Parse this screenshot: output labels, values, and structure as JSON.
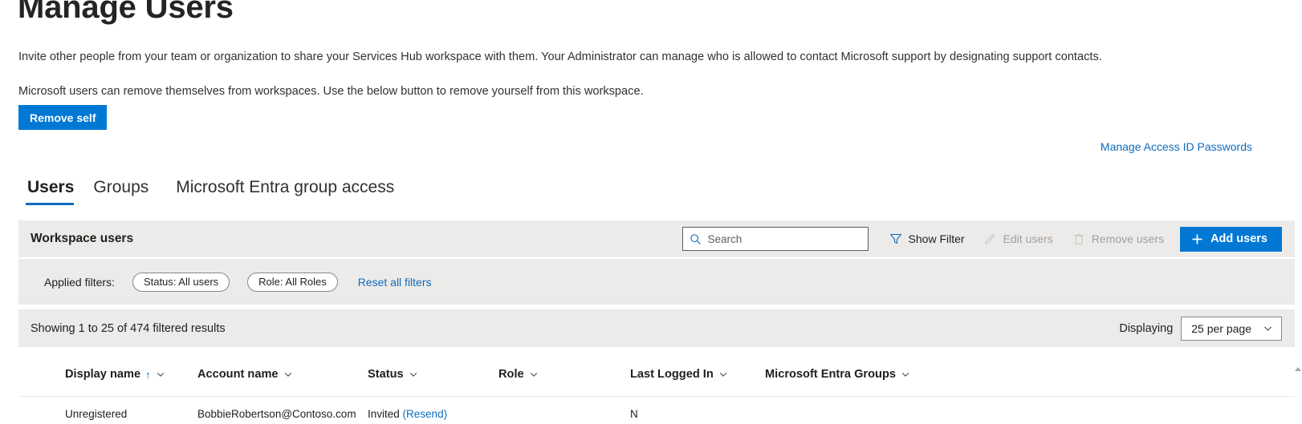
{
  "header": {
    "title": "Manage Users",
    "intro_paragraph_1": "Invite other people from your team or organization to share your Services Hub workspace with them. Your Administrator can manage who is allowed to contact Microsoft support by designating support contacts.",
    "intro_paragraph_2": "Microsoft users can remove themselves from workspaces. Use the below button to remove yourself from this workspace.",
    "remove_self_label": "Remove self",
    "manage_access_link": "Manage Access ID Passwords"
  },
  "tabs": [
    {
      "label": "Users",
      "active": true
    },
    {
      "label": "Groups",
      "active": false
    },
    {
      "label": "Microsoft Entra group access",
      "active": false
    }
  ],
  "toolbar": {
    "panel_title": "Workspace users",
    "search_placeholder": "Search",
    "search_value": "",
    "show_filter_label": "Show Filter",
    "edit_users_label": "Edit users",
    "remove_users_label": "Remove users",
    "add_users_label": "Add users"
  },
  "filters": {
    "applied_label": "Applied filters:",
    "chips": [
      {
        "label": "Status: All users"
      },
      {
        "label": "Role: All Roles"
      }
    ],
    "reset_label": "Reset all filters"
  },
  "paging": {
    "showing_text": "Showing 1 to 25 of 474 filtered results",
    "displaying_label": "Displaying",
    "per_page_value": "25 per page"
  },
  "table": {
    "columns": [
      {
        "label": "Display name",
        "sorted": "asc"
      },
      {
        "label": "Account name",
        "sorted": ""
      },
      {
        "label": "Status",
        "sorted": ""
      },
      {
        "label": "Role",
        "sorted": ""
      },
      {
        "label": "Last Logged In",
        "sorted": ""
      },
      {
        "label": "Microsoft Entra Groups",
        "sorted": ""
      }
    ],
    "rows": [
      {
        "display_name": "Unregistered",
        "account_name": "BobbieRobertson@Contoso.com",
        "status": "Invited",
        "status_action": "(Resend)",
        "role": "",
        "last_logged_in": "N",
        "entra_groups": ""
      }
    ]
  },
  "colors": {
    "accent_blue": "#0078d4",
    "link_blue": "#0f6cbd",
    "band_gray": "#edebe9",
    "disabled_gray": "#a19f9d"
  },
  "icons": {
    "search": "search-icon",
    "filter": "filter-icon",
    "edit": "pencil-icon",
    "remove": "trash-icon",
    "add": "plus-icon",
    "chevron": "chevron-down-icon",
    "sort_asc": "arrow-up-icon"
  }
}
